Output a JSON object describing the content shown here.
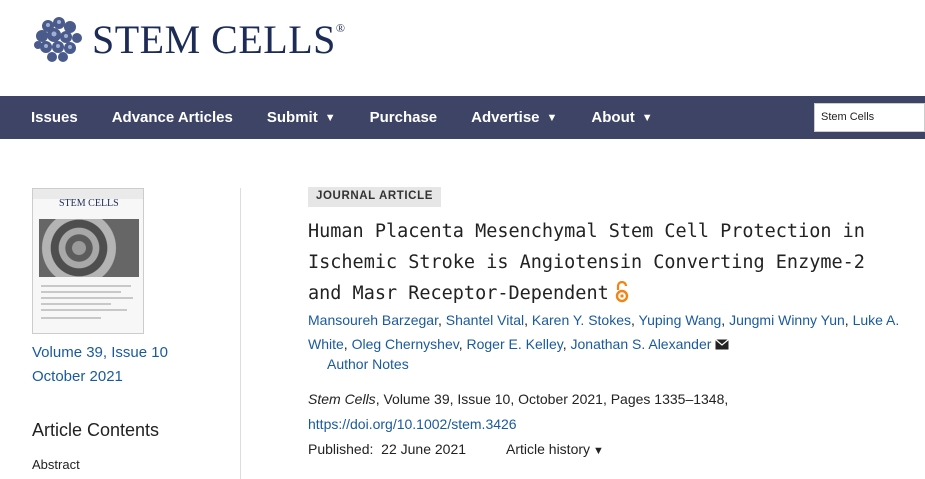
{
  "header": {
    "logo_text": "STEM CELLS",
    "logo_mark": "®",
    "brand_color": "#1d2b57"
  },
  "nav": {
    "background": "#3d4466",
    "items": [
      {
        "label": "Issues",
        "dropdown": false
      },
      {
        "label": "Advance Articles",
        "dropdown": false
      },
      {
        "label": "Submit",
        "dropdown": true
      },
      {
        "label": "Purchase",
        "dropdown": false
      },
      {
        "label": "Advertise",
        "dropdown": true
      },
      {
        "label": "About",
        "dropdown": true
      }
    ],
    "caret": "▼",
    "search_scope": "Stem Cells"
  },
  "sidebar": {
    "cover_title": "STEM CELLS",
    "volume_issue": "Volume 39, Issue 10",
    "issue_date": "October 2021",
    "contents_title": "Article Contents",
    "contents_items": [
      "Abstract"
    ]
  },
  "article": {
    "type_badge": "JOURNAL ARTICLE",
    "title": "Human Placenta Mesenchymal Stem Cell Protection in Ischemic Stroke is Angiotensin Converting Enzyme-2 and Masr Receptor-Dependent",
    "open_access_icon": "open-access-icon",
    "open_access_color": "#f68212",
    "authors": [
      "Mansoureh Barzegar",
      "Shantel Vital",
      "Karen Y. Stokes",
      "Yuping Wang",
      "Jungmi Winny Yun",
      "Luke A. White",
      "Oleg Chernyshev",
      "Roger E. Kelley",
      "Jonathan S. Alexander"
    ],
    "corresponding_icon": "envelope-icon",
    "author_notes_label": "Author Notes",
    "citation_journal": "Stem Cells",
    "citation_rest": ", Volume 39, Issue 10, October 2021, Pages 1335–1348,",
    "doi": "https://doi.org/10.1002/stem.3426",
    "published_label": "Published:",
    "published_date": "22 June 2021",
    "history_label": "Article history",
    "history_caret": "▼",
    "link_color": "#1a5a9c"
  }
}
